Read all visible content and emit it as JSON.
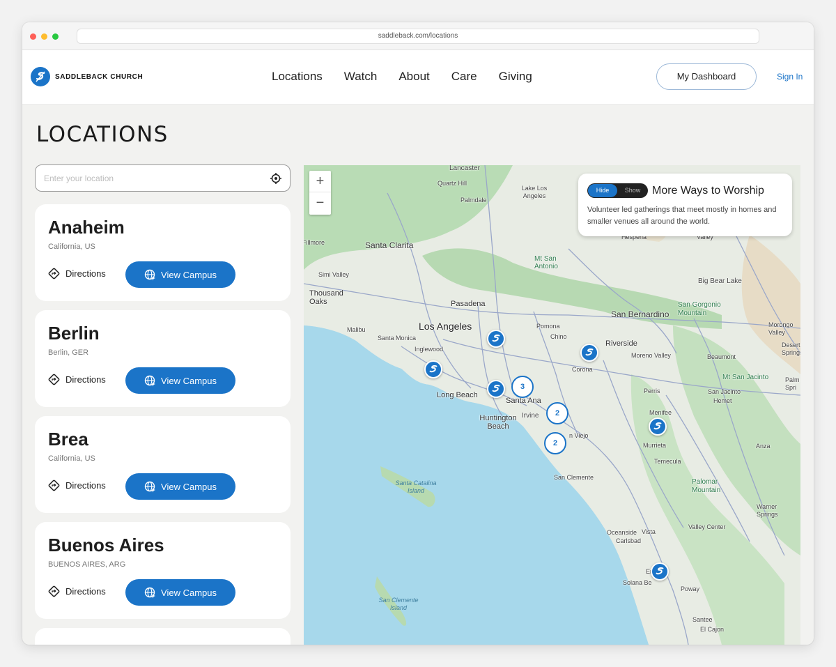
{
  "browser": {
    "url": "saddleback.com/locations"
  },
  "header": {
    "logo_text": "SADDLEBACK CHURCH",
    "nav": [
      "Locations",
      "Watch",
      "About",
      "Care",
      "Giving"
    ],
    "dashboard_label": "My Dashboard",
    "signin_label": "Sign In"
  },
  "page": {
    "title": "LOCATIONS"
  },
  "search": {
    "placeholder": "Enter your location"
  },
  "cards": [
    {
      "name": "Anaheim",
      "region": "California, US",
      "directions": "Directions",
      "view": "View Campus"
    },
    {
      "name": "Berlin",
      "region": "Berlin, GER",
      "directions": "Directions",
      "view": "View Campus"
    },
    {
      "name": "Brea",
      "region": "California, US",
      "directions": "Directions",
      "view": "View Campus"
    },
    {
      "name": "Buenos Aires",
      "region": "BUENOS AIRES, ARG",
      "directions": "Directions",
      "view": "View Campus"
    }
  ],
  "map": {
    "toggle": {
      "hide": "Hide",
      "show": "Show"
    },
    "panel_title": "More Ways to Worship",
    "panel_text": "Volunteer led gatherings that meet mostly in homes and smaller venues all around the world.",
    "clusters": [
      "3",
      "2",
      "2"
    ],
    "labels": {
      "lancaster": "Lancaster",
      "quartz_hill": "Quartz Hill",
      "palmdale": "Palmdale",
      "lake_los_angeles": "Lake Los Angeles",
      "santa_clarita": "Santa Clarita",
      "fillmore": "Fillmore",
      "simi_valley": "Simi Valley",
      "thousand_oaks": "Thousand Oaks",
      "pasadena": "Pasadena",
      "los_angeles": "Los Angeles",
      "malibu": "Malibu",
      "santa_monica": "Santa Monica",
      "inglewood": "Inglewood",
      "pomona": "Pomona",
      "chino": "Chino",
      "long_beach": "Long Beach",
      "santa_ana": "Santa Ana",
      "huntington_beach": "Huntington Beach",
      "irvine": "Irvine",
      "mission_viejo": "n Viejo",
      "corona": "Corona",
      "riverside": "Riverside",
      "moreno_valley": "Moreno Valley",
      "san_bernardino": "San Bernardino",
      "hesperia": "Hesperia",
      "mt_san_antonio": "Mt San Antonio",
      "big_bear_lake": "Big Bear Lake",
      "san_gorgonio": "San Gorgonio Mountain",
      "morongo_valley": "Morongo Valley",
      "desert_springs": "Desert Springs",
      "beaumont": "Beaumont",
      "mt_san_jacinto": "Mt San Jacinto",
      "palm_springs": "Palm Spri",
      "perris": "Perris",
      "menifee": "Menifee",
      "san_jacinto": "San Jacinto",
      "hemet": "Hemet",
      "murrieta": "Murrieta",
      "temecula": "Temecula",
      "anza": "Anza",
      "san_clemente": "San Clemente",
      "palomar_mountain": "Palomar Mountain",
      "warner_springs": "Warner Springs",
      "oceanside": "Oceanside",
      "vista": "Vista",
      "carlsbad": "Carlsbad",
      "valley_center": "Valley Center",
      "encinitas": "Encinita",
      "solana_beach": "Solana Be",
      "poway": "Poway",
      "santee": "Santee",
      "el_cajon": "El Cajon",
      "santa_catalina": "Santa Catalina Island",
      "san_clemente_island": "San Clemente Island",
      "valley": "Valley"
    }
  }
}
